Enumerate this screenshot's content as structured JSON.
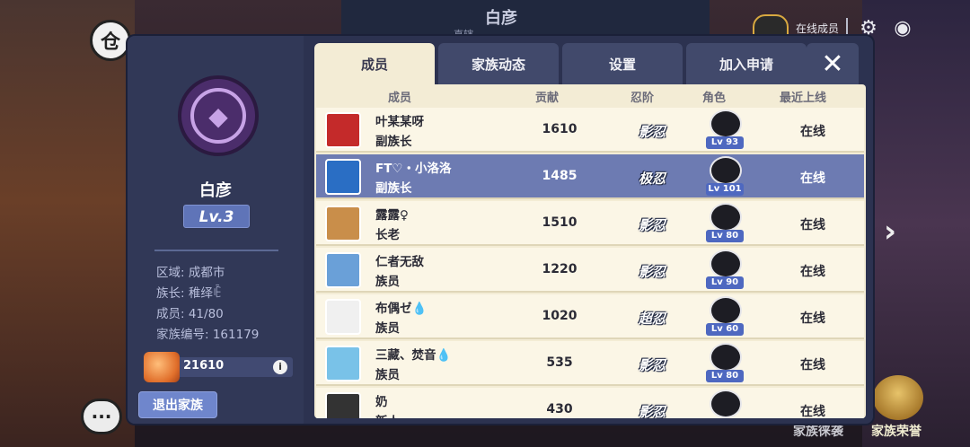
{
  "background": {
    "title": "白彦",
    "subtitle": "直辖",
    "online_label": "在线成员",
    "bottom_links": [
      "家族徕袭",
      "家族荣誉"
    ]
  },
  "clan": {
    "name": "白彦",
    "level": "Lv.3",
    "region": "区域: 成都市",
    "leader": "族长: 稚绎ꍟ",
    "members": "成员: 41/80",
    "clan_id": "家族编号: 161179",
    "gold": "21610",
    "leave_label": "退出家族"
  },
  "tabs": [
    {
      "label": "成员",
      "active": true
    },
    {
      "label": "家族动态",
      "active": false
    },
    {
      "label": "设置",
      "active": false
    },
    {
      "label": "加入申请",
      "active": false
    }
  ],
  "columns": {
    "member": "成员",
    "contribution": "贡献",
    "rank": "忍阶",
    "role_char": "角色",
    "last_online": "最近上线"
  },
  "rows": [
    {
      "name": "叶某某呀",
      "role": "副族长",
      "contribution": "1610",
      "rank": "影忍",
      "char_level": "Lv 93",
      "status": "在线",
      "portrait_color": "#c42a2a",
      "selected": false
    },
    {
      "name": "FT♡・小洛洛",
      "role": "副族长",
      "contribution": "1485",
      "rank": "极忍",
      "char_level": "Lv 101",
      "status": "在线",
      "portrait_color": "#2a6ec4",
      "selected": true
    },
    {
      "name": "露露♀",
      "role": "长老",
      "contribution": "1510",
      "rank": "影忍",
      "char_level": "Lv 80",
      "status": "在线",
      "portrait_color": "#c98e4a",
      "selected": false
    },
    {
      "name": "仁者无敌",
      "role": "族员",
      "contribution": "1220",
      "rank": "影忍",
      "char_level": "Lv 90",
      "status": "在线",
      "portrait_color": "#6aa0d8",
      "selected": false
    },
    {
      "name": "布偶ゼ💧",
      "role": "族员",
      "contribution": "1020",
      "rank": "超忍",
      "char_level": "Lv 60",
      "status": "在线",
      "portrait_color": "#f0f0f0",
      "selected": false
    },
    {
      "name": "三藏、焚音💧",
      "role": "族员",
      "contribution": "535",
      "rank": "影忍",
      "char_level": "Lv 80",
      "status": "在线",
      "portrait_color": "#79c2e8",
      "selected": false
    },
    {
      "name": "奶",
      "role": "新人",
      "contribution": "430",
      "rank": "影忍",
      "char_level": "",
      "status": "在线",
      "portrait_color": "#333333",
      "selected": false
    }
  ]
}
